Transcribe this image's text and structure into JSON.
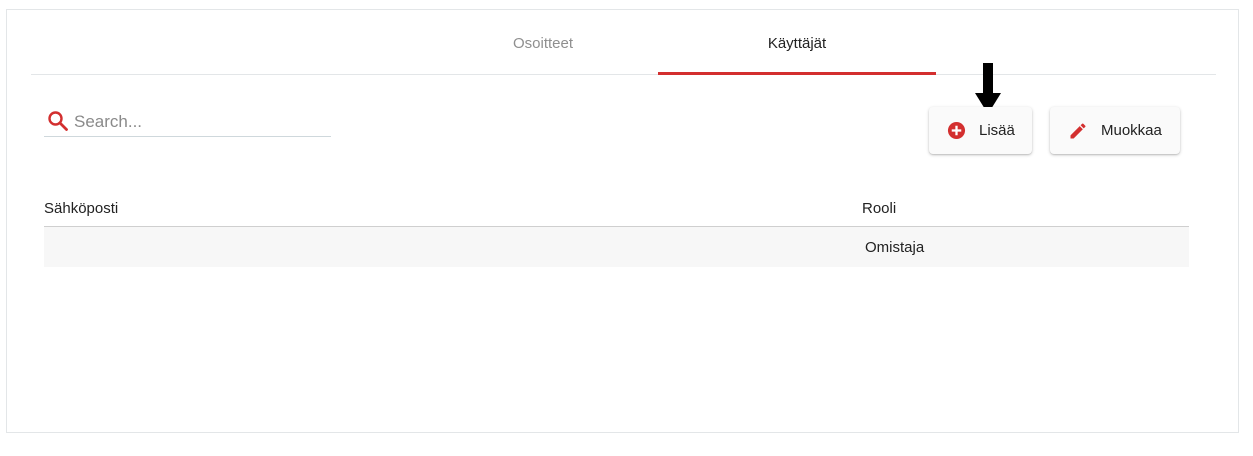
{
  "tabs": [
    {
      "label": "Osoitteet",
      "active": false
    },
    {
      "label": "Käyttäjät",
      "active": true
    }
  ],
  "search": {
    "placeholder": "Search...",
    "value": ""
  },
  "toolbar": {
    "add_label": "Lisää",
    "edit_label": "Muokkaa"
  },
  "table": {
    "columns": [
      "Sähköposti",
      "Rooli"
    ],
    "rows": [
      {
        "email": "",
        "role": "Omistaja"
      }
    ]
  },
  "colors": {
    "accent": "#d32f2f"
  },
  "icons": {
    "search": "search-icon",
    "add": "add-circle-icon",
    "edit": "pencil-icon",
    "pointer": "down-arrow-icon"
  }
}
